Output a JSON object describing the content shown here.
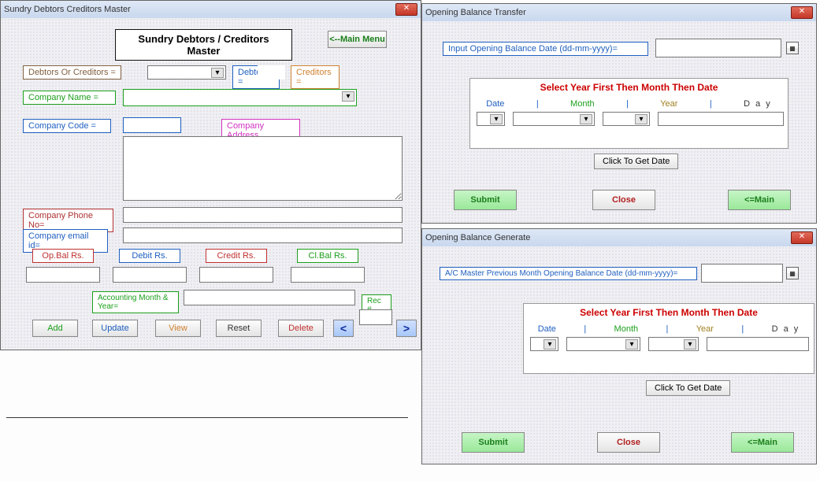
{
  "master": {
    "title": "Sundry Debtors Creditors  Master",
    "heading": "Sundry Debtors / Creditors Master",
    "main_menu": "<--Main Menu",
    "debtors_or_creditors": "Debtors Or Creditors =",
    "debtors_eq": "Debtors =",
    "creditors_eq": "Creditors =",
    "company_name": "Company Name  =",
    "company_code": "Company Code   =",
    "company_address": "Company Address",
    "company_phone": "Company Phone No=",
    "company_email": "Company email id=",
    "opbal": "Op.Bal Rs.",
    "debit": "Debit Rs.",
    "credit": "Credit Rs.",
    "clbal": "Cl.Bal Rs.",
    "acct_month_year": "Accounting Month & Year=",
    "rec": "Rec #",
    "add": "Add",
    "update": "Update",
    "view": "View",
    "reset": "Reset",
    "delete": "Delete",
    "prev": "<",
    "next": ">"
  },
  "transfer": {
    "title": "Opening Balance Transfer",
    "input_label": "Input Opening Balance Date (dd-mm-yyyy)=",
    "select_head": "Select Year First Then Month Then Date",
    "col_date": "Date",
    "col_month": "Month",
    "col_year": "Year",
    "col_day": "D a y",
    "click_get": "Click To Get Date",
    "submit": "Submit",
    "close": "Close",
    "main": "<=Main"
  },
  "generate": {
    "title": "Opening Balance Generate",
    "input_label": "A/C Master Previous Month Opening Balance Date (dd-mm-yyyy)=",
    "select_head": "Select Year First Then Month Then Date",
    "col_date": "Date",
    "col_month": "Month",
    "col_year": "Year",
    "col_day": "D a y",
    "click_get": "Click To Get Date",
    "submit": "Submit",
    "close": "Close",
    "main": "<=Main"
  }
}
